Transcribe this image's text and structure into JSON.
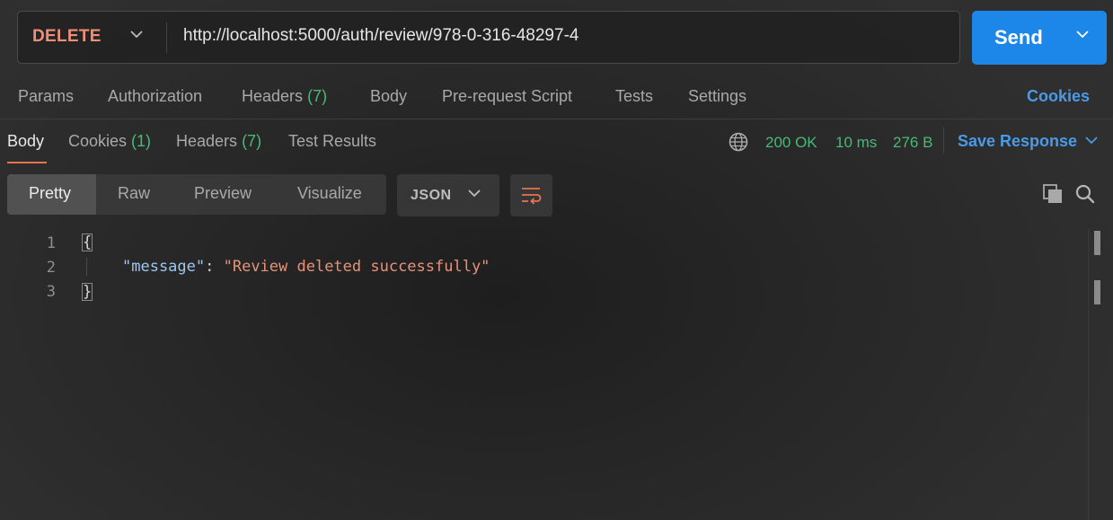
{
  "request": {
    "method": "DELETE",
    "url": "http://localhost:5000/auth/review/978-0-316-48297-4",
    "send_label": "Send"
  },
  "request_tabs": {
    "params": "Params",
    "authorization": "Authorization",
    "headers": "Headers",
    "headers_count": "(7)",
    "body": "Body",
    "prerequest": "Pre-request Script",
    "tests": "Tests",
    "settings": "Settings",
    "cookies": "Cookies"
  },
  "response_tabs": {
    "body": "Body",
    "cookies": "Cookies",
    "cookies_count": "(1)",
    "headers": "Headers",
    "headers_count": "(7)",
    "test_results": "Test Results"
  },
  "response_meta": {
    "status": "200 OK",
    "time": "10 ms",
    "size": "276 B",
    "save_response": "Save Response"
  },
  "view_modes": {
    "pretty": "Pretty",
    "raw": "Raw",
    "preview": "Preview",
    "visualize": "Visualize",
    "format": "JSON"
  },
  "code": {
    "line_numbers": [
      "1",
      "2",
      "3"
    ],
    "open_brace": "{",
    "close_brace": "}",
    "key": "\"message\"",
    "colon": ": ",
    "value": "\"Review deleted successfully\""
  },
  "icons": {
    "method_dropdown": "chevron-down-icon",
    "send_dropdown": "chevron-down-icon",
    "network": "globe-icon",
    "wrap": "wrap-lines-icon",
    "copy": "copy-icon",
    "search": "search-icon"
  },
  "colors": {
    "method": "#ef8f79",
    "send_bg": "#1c87e8",
    "status_ok": "#49b976",
    "accent_link": "#4a9ae8",
    "active_underline": "#e8734e",
    "json_key": "#9cc8f0",
    "json_string": "#e8927a"
  }
}
